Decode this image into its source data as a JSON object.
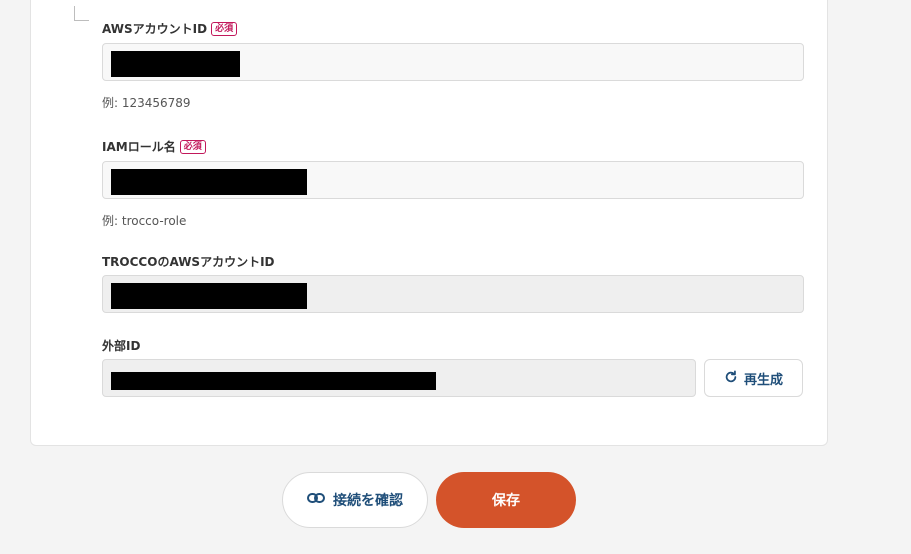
{
  "form": {
    "aws_account_id": {
      "label": "AWSアカウントID",
      "required_badge": "必須",
      "hint": "例: 123456789"
    },
    "iam_role_name": {
      "label": "IAMロール名",
      "required_badge": "必須",
      "hint": "例: trocco-role"
    },
    "trocco_aws_account_id": {
      "label": "TROCCOのAWSアカウントID"
    },
    "external_id": {
      "label": "外部ID"
    },
    "regenerate_label": "再生成"
  },
  "actions": {
    "test_connection_label": "接続を確認",
    "save_label": "保存"
  },
  "colors": {
    "accent": "#d4532a",
    "link_text": "#1f4e79",
    "required": "#c2185b"
  },
  "icons": {
    "regenerate": "refresh-icon",
    "test_connection": "link-icon"
  }
}
